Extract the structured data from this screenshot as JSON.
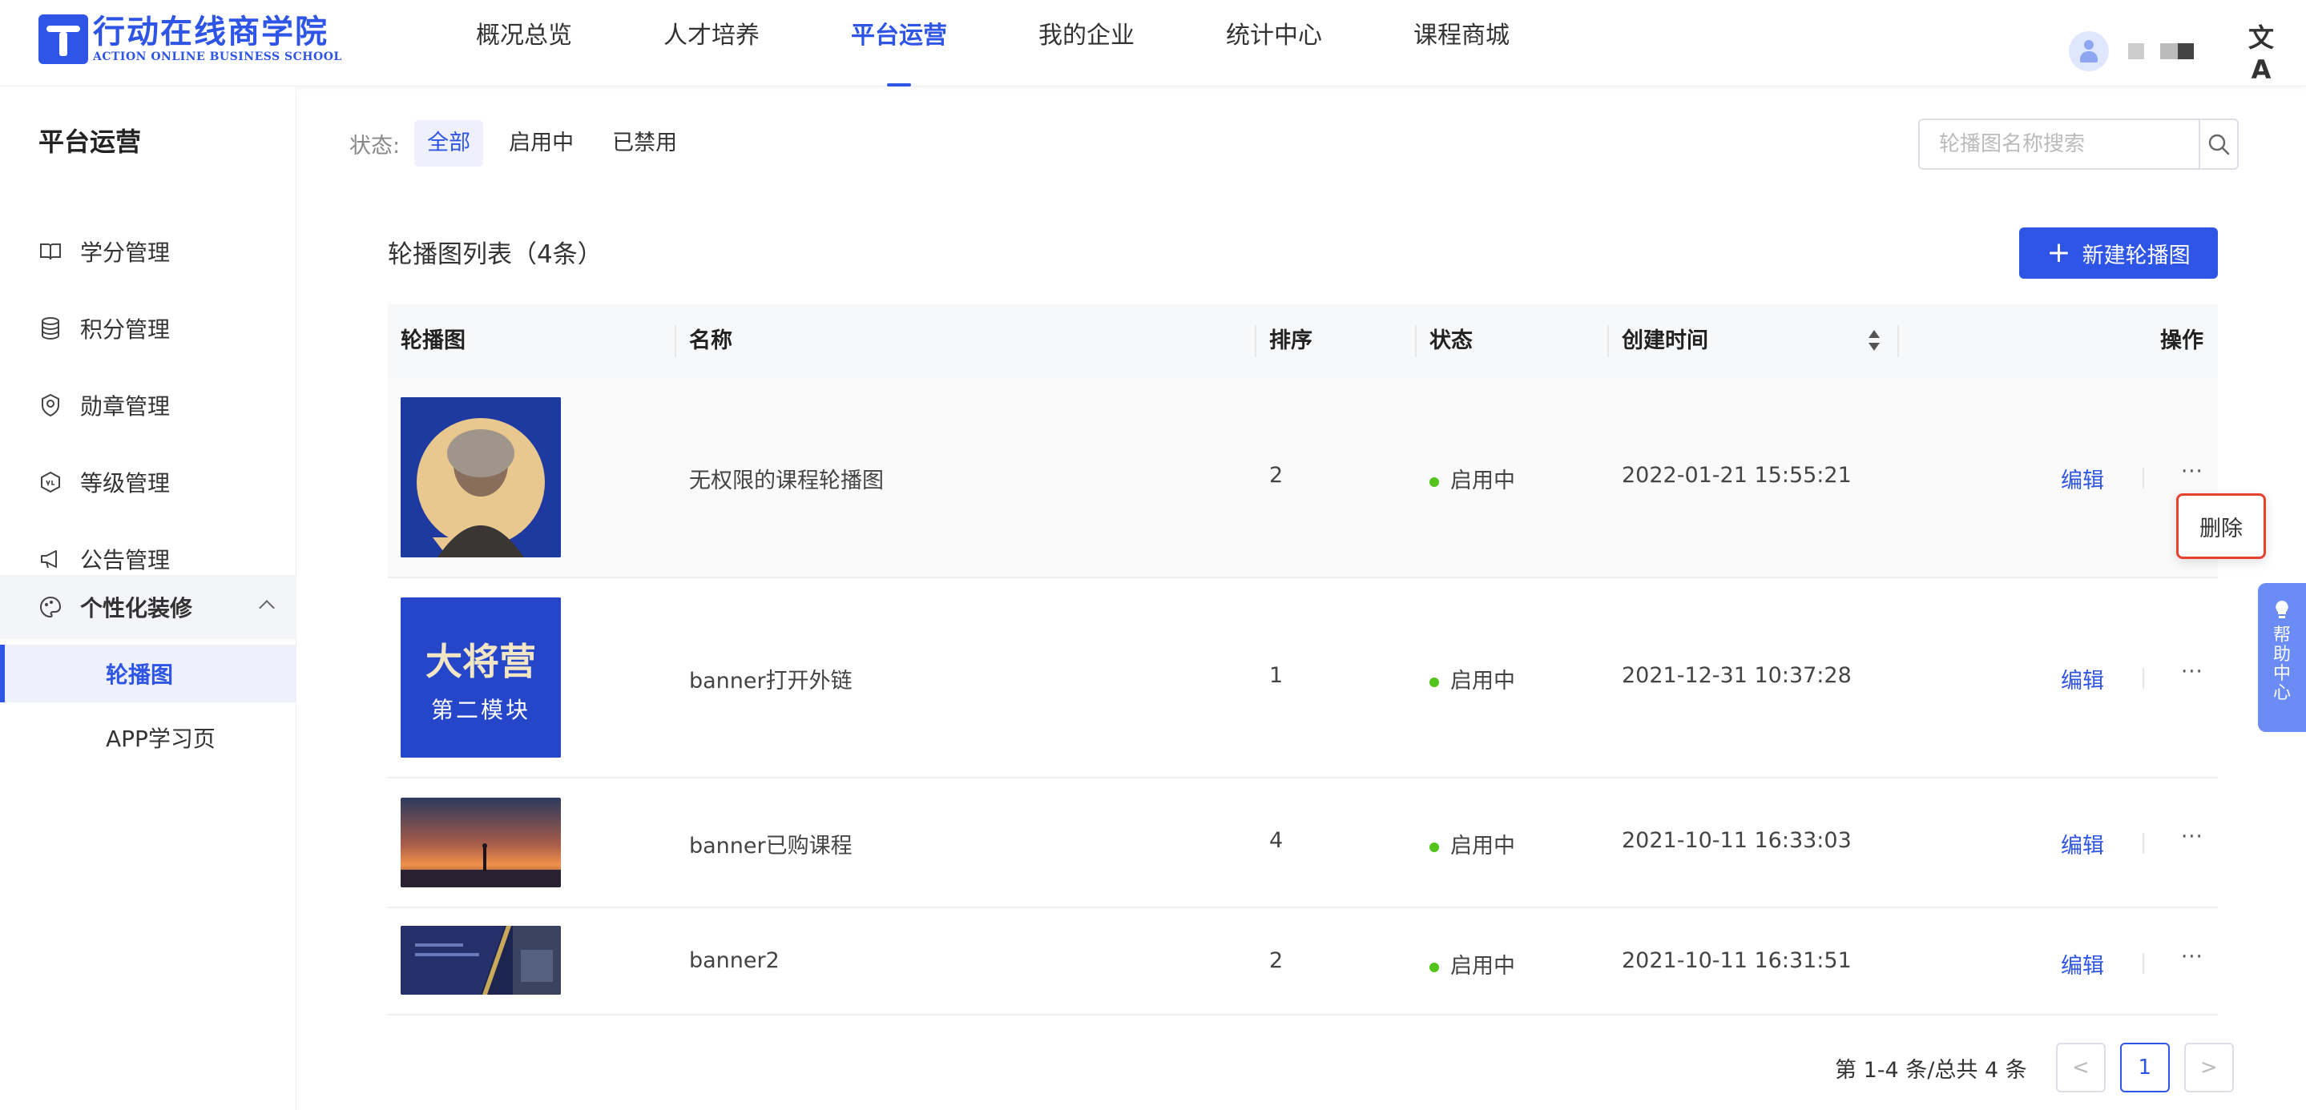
{
  "header": {
    "logo_cn": "行动在线商学院",
    "logo_en": "ACTION ONLINE BUSINESS SCHOOL",
    "nav": [
      "概况总览",
      "人才培养",
      "平台运营",
      "我的企业",
      "统计中心",
      "课程商城"
    ],
    "active_nav": "平台运营",
    "translate_icon": "文A"
  },
  "sidebar": {
    "title": "平台运营",
    "items": [
      {
        "label": "学分管理",
        "icon": "book-icon"
      },
      {
        "label": "积分管理",
        "icon": "database-icon"
      },
      {
        "label": "勋章管理",
        "icon": "medal-icon"
      },
      {
        "label": "等级管理",
        "icon": "level-icon"
      },
      {
        "label": "公告管理",
        "icon": "megaphone-icon"
      }
    ],
    "group": {
      "label": "个性化装修",
      "icon": "palette-icon"
    },
    "sub_items": [
      "轮播图",
      "APP学习页"
    ],
    "active_sub": "轮播图"
  },
  "filter": {
    "label": "状态:",
    "options": [
      "全部",
      "启用中",
      "已禁用"
    ],
    "active": "全部"
  },
  "search": {
    "placeholder": "轮播图名称搜索"
  },
  "list": {
    "title": "轮播图列表（4条）",
    "new_button": "新建轮播图"
  },
  "table": {
    "columns": [
      "轮播图",
      "名称",
      "排序",
      "状态",
      "创建时间",
      "操作"
    ],
    "rows": [
      {
        "name": "无权限的课程轮播图",
        "order": "2",
        "status": "启用中",
        "created": "2022-01-21 15:55:21",
        "edit": "编辑",
        "more": "···"
      },
      {
        "name": "banner打开外链",
        "order": "1",
        "status": "启用中",
        "created": "2021-12-31 10:37:28",
        "edit": "编辑",
        "more": "···",
        "thumb_title": "大将营",
        "thumb_sub": "第二模块"
      },
      {
        "name": "banner已购课程",
        "order": "4",
        "status": "启用中",
        "created": "2021-10-11 16:33:03",
        "edit": "编辑",
        "more": "···"
      },
      {
        "name": "banner2",
        "order": "2",
        "status": "启用中",
        "created": "2021-10-11 16:31:51",
        "edit": "编辑",
        "more": "···"
      }
    ]
  },
  "dropdown": {
    "delete_label": "删除"
  },
  "pagination": {
    "summary": "第 1-4 条/总共 4 条",
    "prev": "<",
    "current": "1",
    "next": ">"
  },
  "help": {
    "label": "帮助中心"
  },
  "colors": {
    "primary": "#2f55e6",
    "success": "#52c41a",
    "highlight": "#e8422f"
  }
}
